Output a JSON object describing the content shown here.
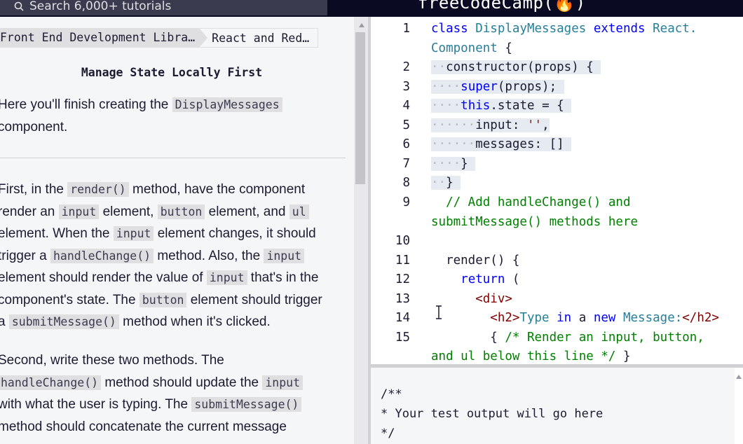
{
  "nav": {
    "search_placeholder": "Search 6,000+ tutorials",
    "brand": "freeCodeCamp(🔥)"
  },
  "breadcrumb": {
    "crumb1": "Front End Development Libra…",
    "crumb2": "React and Red…"
  },
  "lesson": {
    "title": "Manage State Locally First",
    "p1": {
      "t1": "Here you'll finish creating the ",
      "c1": "DisplayMessages",
      "t2": "component."
    },
    "p2": {
      "t1": "First, in the ",
      "c1": "render()",
      "t2": " method, have the component",
      "t3": "render an ",
      "c2": "input",
      "t4": " element, ",
      "c3": "button",
      "t5": " element, and ",
      "c4": "ul",
      "t6": "element. When the ",
      "c5": "input",
      "t7": " element changes, it should",
      "t8": "trigger a ",
      "c6": "handleChange()",
      "t9": " method. Also, the ",
      "c7": "input",
      "t10": "element should render the value of ",
      "c8": "input",
      "t11": " that's in the",
      "t12": "component's state. The ",
      "c9": "button",
      "t13": " element should trigger",
      "t14": "a ",
      "c10": "submitMessage()",
      "t15": " method when it's clicked."
    },
    "p3": {
      "t1": "Second, write these two methods. The",
      "c1": "handleChange()",
      "t2": " method should update the ",
      "c2": "input",
      "t3": "with what the user is typing. The ",
      "c3": "submitMessage()",
      "t4": "method should concatenate the current message"
    }
  },
  "editor": {
    "line_numbers": [
      "1",
      "2",
      "3",
      "4",
      "5",
      "6",
      "7",
      "8",
      "9",
      "10",
      "11",
      "12",
      "13",
      "14",
      "15"
    ],
    "l1a_kw": "class",
    "l1a_ty": "DisplayMessages",
    "l1a_kw2": "extends",
    "l1a_ty2": "React.",
    "l1b_ty": "Component",
    "l1b_p": " {",
    "l2_ws": "··",
    "l2_code": "constructor(props) {",
    "l3_ws": "····",
    "l3_kw": "super",
    "l3_code": "(props);",
    "l4_ws": "····",
    "l4_kw": "this",
    "l4_code": ".state = {",
    "l5_ws": "······",
    "l5_code": "input: ",
    "l5_str": "''",
    "l5_end": ",",
    "l6_ws": "······",
    "l6_code": "messages: []",
    "l7_ws": "····",
    "l7_code": "}",
    "l8_ws": "··",
    "l8_code": "}",
    "l9a": "// Add handleChange() and",
    "l9b": "submitMessage() methods here",
    "l11": "render() {",
    "l12_kw": "return",
    "l12_p": " (",
    "l13": "<div>",
    "l14_tag1": "<h2>",
    "l14_text1": "Type ",
    "l14_kw": "in",
    "l14_text2": " a ",
    "l14_kw2": "new",
    "l14_text3": " Message:",
    "l14_tag2": "</h2>",
    "l15a_p": "{ ",
    "l15a_cm": "/* Render an input, button,",
    "l15b_cm": "and ul below this line */",
    "l15b_p": " }"
  },
  "console": {
    "line1": "/**",
    "line2": "* Your test output will go here",
    "line3": "*/"
  }
}
